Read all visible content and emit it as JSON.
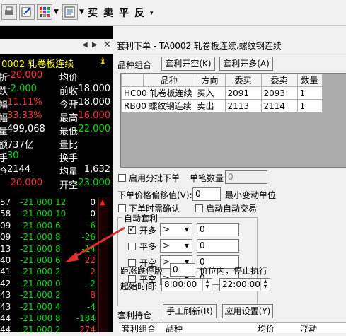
{
  "toolbar": {
    "buttons": [
      "print-icon",
      "edit-icon",
      "grid-icon",
      "dropdown-icon"
    ],
    "trade_labels": [
      "买",
      "卖",
      "平",
      "反"
    ]
  },
  "left": {
    "symbol": "0002 轧卷板连续",
    "quote_rows": [
      {
        "k1": "折",
        "v1": "-20.000",
        "k2": "均价",
        "v2": ""
      },
      {
        "k1": "跌",
        "v1": "-2.000",
        "k2": "前收",
        "v2": "-18.000"
      },
      {
        "k1": "幅",
        "v1": "11.11%",
        "k2": "今开",
        "v2": "-18.000"
      },
      {
        "k1": "幅",
        "v1": "33.33%",
        "k2": "最高",
        "v2": "-16.000"
      },
      {
        "k1": "量",
        "v1": "499,068",
        "k2": "最低",
        "v2": "-22.000"
      },
      {
        "k1": "额",
        "v1": "737亿",
        "k2": "量比",
        "v2": ""
      },
      {
        "k1": "手",
        "v1": "30",
        "k2": "换手",
        "v2": ""
      },
      {
        "k1": "仓",
        "v1": "2144",
        "k2": "均量",
        "v2": "1,632"
      },
      {
        "k1": "",
        "v1": "-20.000",
        "k2": "开空",
        "v2": "-23.000"
      }
    ],
    "ticks": [
      {
        "t": "57",
        "p": "-21.000",
        "a": "12",
        "b": "0",
        "bc": "white"
      },
      {
        "t": "58",
        "p": "-21.000",
        "a": "10",
        "b": "0",
        "bc": "white"
      },
      {
        "t": "09",
        "p": "-21.000",
        "a": "6",
        "b": "-6",
        "bc": "green"
      },
      {
        "t": "09",
        "p": "-21.000",
        "a": "8",
        "b": "-26",
        "bc": "green"
      },
      {
        "t": "13",
        "p": "-21.000",
        "a": "8",
        "b": "-14",
        "bc": "green"
      },
      {
        "t": "40",
        "p": "-21.000",
        "a": "6",
        "b": "22",
        "bc": "red"
      },
      {
        "t": "41",
        "p": "-21.000",
        "a": "2",
        "b": "2",
        "bc": "red"
      },
      {
        "t": "42",
        "p": "-21.000",
        "a": "0",
        "b": "-2",
        "bc": "green"
      },
      {
        "t": "43",
        "p": "-21.000",
        "a": "2",
        "b": "8",
        "bc": "red"
      },
      {
        "t": "43",
        "p": "-21.000",
        "a": "4",
        "b": "-4",
        "bc": "green"
      },
      {
        "t": "44",
        "p": "-21.000",
        "a": "8",
        "b": "-184",
        "bc": "green"
      },
      {
        "t": "44",
        "p": "-21.000",
        "a": "2",
        "b": "274",
        "bc": "red"
      }
    ]
  },
  "right": {
    "title": "套利下单 - TA0002 轧卷板连续.螺纹钢连续",
    "combo_label": "品种组合",
    "btn_open_short": "套利开空(K)",
    "btn_open_long": "套利开多(A)",
    "table_headers": [
      "品种",
      "方向",
      "委买",
      "委卖",
      "数量"
    ],
    "table_rows": [
      {
        "code": "HC00",
        "name": "轧卷板连续",
        "dir": "买入",
        "bid": "2091",
        "ask": "2093",
        "qty": "1"
      },
      {
        "code": "RB00",
        "name": "螺纹钢连续",
        "dir": "卖出",
        "bid": "2113",
        "ask": "2114",
        "qty": "1"
      }
    ],
    "batch_label": "启用分批下单",
    "per_qty_label": "单笔数量",
    "per_qty_value": "0",
    "offset_label": "下单价格偏移值(V):",
    "offset_value": "0",
    "offset_unit": "最小变动单位",
    "confirm_label": "下单时需确认",
    "auto_trade_label": "启动自动交易",
    "auto_title": "自动套利",
    "auto_rows": [
      {
        "label": "开多",
        "checked": true,
        "op": ">",
        "val": "0"
      },
      {
        "label": "平多",
        "checked": false,
        "op": ">",
        "val": "0"
      },
      {
        "label": "开空",
        "checked": false,
        "op": ">",
        "val": "0"
      },
      {
        "label": "平空",
        "checked": false,
        "op": ">",
        "val": "0"
      }
    ],
    "stop_label_a": "距涨跌停版",
    "stop_value": "0",
    "stop_label_b": "价位内，停止执行",
    "time_label": "起始时间:",
    "time_start": "8:00:00",
    "time_end": "22:00:00",
    "hold_label": "套利持仓",
    "btn_refresh": "手工刷新(R)",
    "btn_settings": "应用设置(Y)",
    "hold_headers": [
      "套利组合",
      "品种",
      "均价",
      "浮动"
    ]
  }
}
